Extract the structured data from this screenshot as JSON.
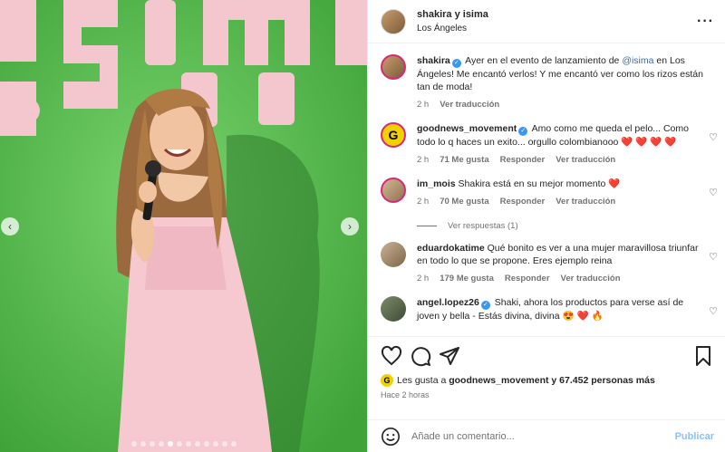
{
  "header": {
    "title": "shakira y isima",
    "location": "Los Ángeles",
    "more_icon": "more-horizontal-icon"
  },
  "caption": {
    "user": "shakira",
    "text_before": "Ayer en el evento de lanzamiento de ",
    "mention": "@isima",
    "text_after": " en Los Ángeles! Me encantó verlos! Y me encantó ver como los rizos están tan de moda!",
    "time": "2 h",
    "translate": "Ver traducción"
  },
  "comments": [
    {
      "user": "goodnews_movement",
      "verified": true,
      "text": "Amo como me queda el pelo... Como todo lo q haces un exito... orgullo colombianooo",
      "emoji": "❤️ ❤️ ❤️ ❤️",
      "time": "2 h",
      "likes": "71 Me gusta",
      "reply": "Responder",
      "translate": "Ver traducción",
      "avatar_color": "#f3d100"
    },
    {
      "user": "im_mois",
      "verified": false,
      "text": "Shakira está en su mejor momento",
      "emoji": "❤️",
      "time": "2 h",
      "likes": "70 Me gusta",
      "reply": "Responder",
      "translate": "Ver traducción",
      "view_replies": "Ver respuestas (1)",
      "avatar_color": "#b89a72"
    },
    {
      "user": "eduardokatime",
      "verified": false,
      "text": "Qué bonito es ver a una mujer maravillosa triunfar en todo lo que se propone. Eres ejemplo reina",
      "emoji": "",
      "time": "2 h",
      "likes": "179 Me gusta",
      "reply": "Responder",
      "translate": "Ver traducción",
      "avatar_color": "#a48d6f"
    },
    {
      "user": "angel.lopez26",
      "verified": true,
      "text": "Shaki, ahora los productos para verse así de joven y bella - Estás divina, divina",
      "emoji": "😍 ❤️ 🔥",
      "avatar_color": "#5a6b4a"
    }
  ],
  "likes": {
    "prefix": "Les gusta a ",
    "user": "goodnews_movement",
    "suffix": " y 67.452 personas más"
  },
  "posted": "Hace 2 horas",
  "composer": {
    "placeholder": "Añade un comentario...",
    "post_label": "Publicar"
  },
  "media": {
    "wall_letters": "ísima",
    "slides": 12,
    "active_slide": 4,
    "colors": {
      "wall": "#4fb548",
      "letters": "#f4c7cf",
      "dress": "#f5c9cf",
      "hair": "#9a6a3e"
    }
  },
  "colors": {
    "accent": "#0095f6",
    "verified": "#3897f0",
    "heart": "#e0245e"
  }
}
